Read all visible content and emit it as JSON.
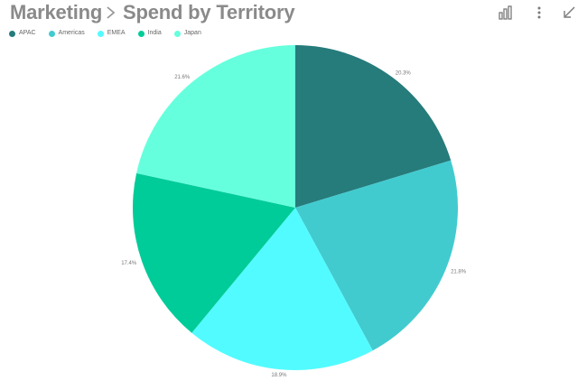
{
  "header": {
    "breadcrumb_root": "Marketing",
    "title": "Spend by Territory",
    "icons": [
      "bar-chart-icon",
      "more-vertical-icon",
      "collapse-icon"
    ]
  },
  "colors": {
    "text_gray": "#8a8a8a",
    "icon_gray": "#7a7a7a"
  },
  "chart_data": {
    "type": "pie",
    "title": "Spend by Territory",
    "legend_position": "top-left",
    "start_angle_deg": 0,
    "direction": "clockwise",
    "slices": [
      {
        "name": "APAC",
        "value": 20.3,
        "label": "20.3%",
        "color": "#267b7b"
      },
      {
        "name": "Americas",
        "value": 21.8,
        "label": "21.8%",
        "color": "#41cbcf"
      },
      {
        "name": "EMEA",
        "value": 18.9,
        "label": "18.9%",
        "color": "#52fbff"
      },
      {
        "name": "India",
        "value": 17.4,
        "label": "17.4%",
        "color": "#00cc99"
      },
      {
        "name": "Japan",
        "value": 21.6,
        "label": "21.6%",
        "color": "#66ffdd"
      }
    ]
  }
}
